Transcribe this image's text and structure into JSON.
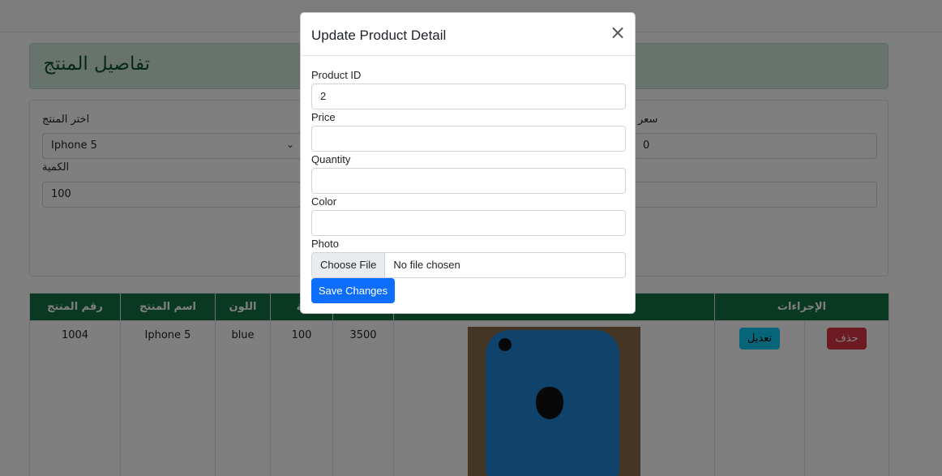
{
  "page": {
    "title": "تفاصيل المنتج"
  },
  "form": {
    "select_product_label": "اختر المنتج",
    "select_product_value": "Iphone 5",
    "quantity_label": "الكمية",
    "quantity_value": "100",
    "price_label": "سعر",
    "price_value": "0"
  },
  "table": {
    "headers": [
      "رقم المنتج",
      "اسم المنتج",
      "اللون",
      "ية",
      "",
      "",
      "الإجراءات"
    ],
    "row": {
      "id": "1004",
      "name": "Iphone 5",
      "color": "blue",
      "quantity": "100",
      "price": "3500",
      "edit_label": "تعديل",
      "delete_label": "حذف"
    }
  },
  "modal": {
    "title": "Update Product Detail",
    "close_icon": "close-icon",
    "product_id_label": "Product ID",
    "product_id_value": "2",
    "price_label": "Price",
    "price_value": "",
    "quantity_label": "Quantity",
    "quantity_value": "",
    "color_label": "Color",
    "color_value": "",
    "photo_label": "Photo",
    "choose_file_label": "Choose File",
    "no_file_text": "No file chosen",
    "save_label": "Save Changes"
  },
  "colors": {
    "header_bg": "#d1e7dd",
    "table_header_bg": "#157347",
    "primary": "#0d6efd",
    "info": "#0dcaf0",
    "danger": "#dc3545"
  }
}
